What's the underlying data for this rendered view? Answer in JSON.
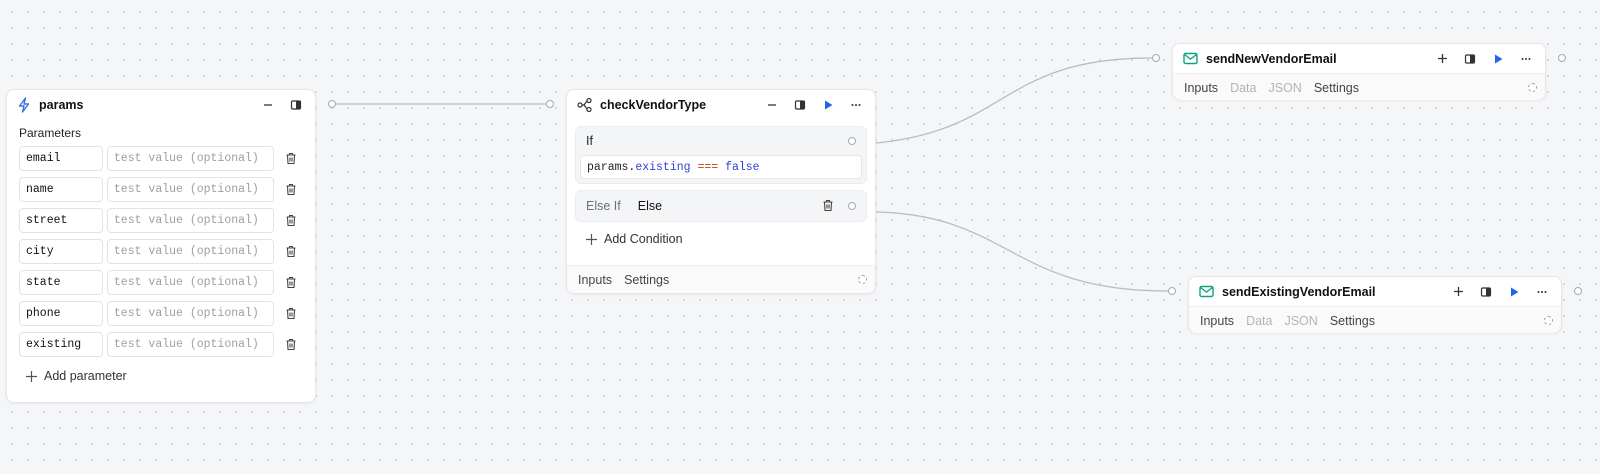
{
  "params_node": {
    "title": "params",
    "section_label": "Parameters",
    "placeholder": "test value (optional)",
    "params": [
      "email",
      "name",
      "street",
      "city",
      "state",
      "phone",
      "existing"
    ],
    "add_label": "Add parameter",
    "icon": "lightning-icon"
  },
  "check_node": {
    "title": "checkVendorType",
    "if_label": "If",
    "expr": {
      "obj": "params",
      "dot": ".",
      "prop": "existing",
      "op": "===",
      "val": "false"
    },
    "elseif_label": "Else If",
    "else_label": "Else",
    "add_condition_label": "Add Condition",
    "tabs": [
      "Inputs",
      "Settings"
    ],
    "icon": "branch-icon"
  },
  "email_new_node": {
    "title": "sendNewVendorEmail",
    "tabs": [
      "Inputs",
      "Data",
      "JSON",
      "Settings"
    ],
    "icon": "mail-icon"
  },
  "email_existing_node": {
    "title": "sendExistingVendorEmail",
    "tabs": [
      "Inputs",
      "Data",
      "JSON",
      "Settings"
    ],
    "icon": "mail-icon"
  },
  "colors": {
    "play": "#2563eb",
    "mail": "#10a37f",
    "lightning": "#3b6fe0",
    "expr_prop": "#2f3fd4",
    "expr_op": "#c2410c",
    "expr_val": "#2f3fd4",
    "edge": "#b8bcc3"
  }
}
